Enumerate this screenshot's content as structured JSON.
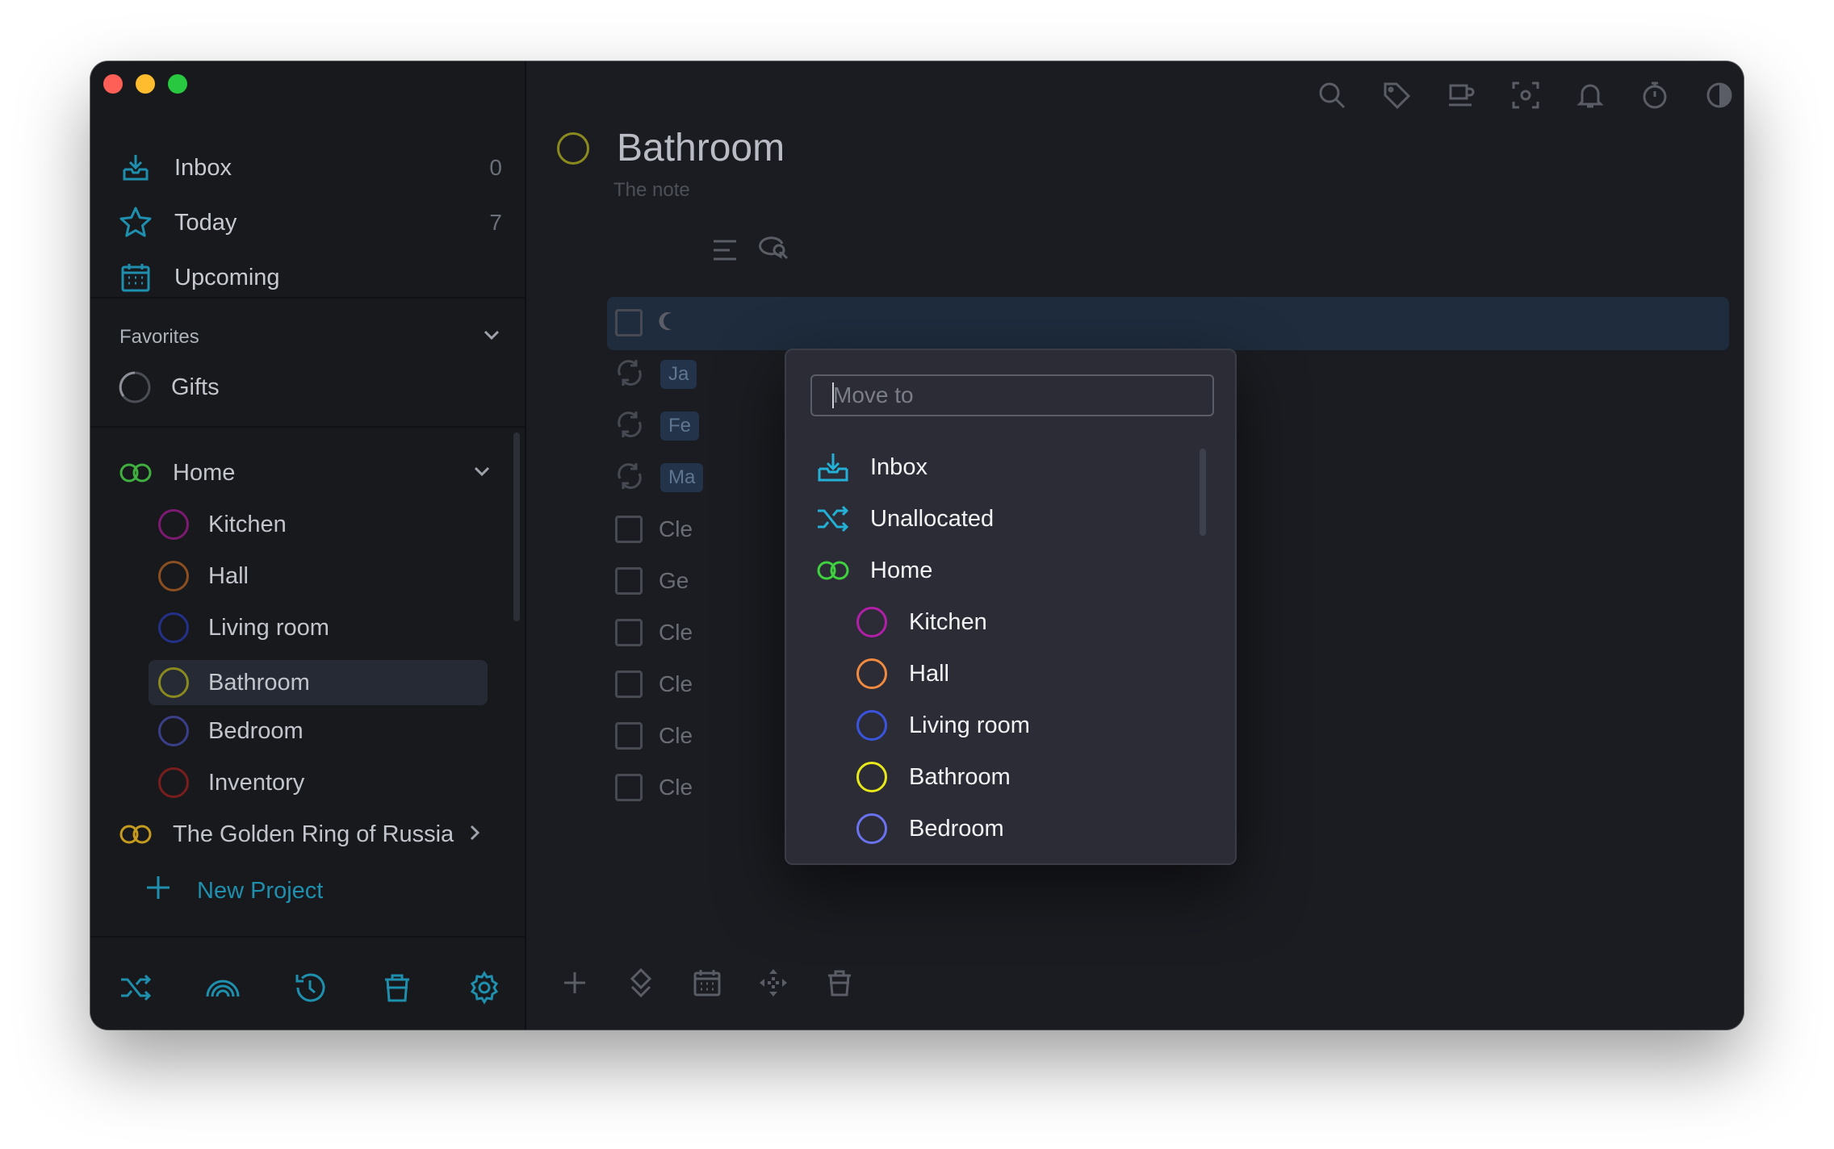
{
  "sidebar": {
    "nav": [
      {
        "label": "Inbox",
        "count": "0"
      },
      {
        "label": "Today",
        "count": "7"
      },
      {
        "label": "Upcoming",
        "count": ""
      }
    ],
    "favorites_label": "Favorites",
    "favorites": [
      {
        "label": "Gifts"
      }
    ],
    "home_label": "Home",
    "home_children": [
      {
        "label": "Kitchen",
        "color": "#7d1a72"
      },
      {
        "label": "Hall",
        "color": "#8c4f22"
      },
      {
        "label": "Living room",
        "color": "#23318a"
      },
      {
        "label": "Bathroom",
        "color": "#8a8a1f"
      },
      {
        "label": "Bedroom",
        "color": "#3a3f8a"
      },
      {
        "label": "Inventory",
        "color": "#7a1d1d"
      }
    ],
    "golden_ring_label": "The Golden Ring of Russia",
    "new_project_label": "New Project"
  },
  "main": {
    "title": "Bathroom",
    "note": "The note",
    "tasks": [
      {
        "text": "",
        "type": "checkbox"
      },
      {
        "text": "",
        "tag": "Ja",
        "type": "repeat"
      },
      {
        "text": "",
        "tag": "Fe",
        "type": "repeat"
      },
      {
        "text": "",
        "tag": "Ma",
        "type": "repeat"
      },
      {
        "text": "Cle",
        "type": "checkbox"
      },
      {
        "text": "Ge",
        "type": "checkbox"
      },
      {
        "text": "Cle",
        "type": "checkbox"
      },
      {
        "text": "Cle",
        "type": "checkbox"
      },
      {
        "text": "Cle",
        "type": "checkbox"
      },
      {
        "text": "Cle",
        "type": "checkbox"
      }
    ]
  },
  "move_popup": {
    "placeholder": "Move to",
    "items": [
      {
        "label": "Inbox",
        "icon": "inbox-icon"
      },
      {
        "label": "Unallocated",
        "icon": "shuffle-icon"
      },
      {
        "label": "Home",
        "icon": "rings-icon"
      },
      {
        "label": "Kitchen",
        "color": "#b31fa8"
      },
      {
        "label": "Hall",
        "color": "#f08a40"
      },
      {
        "label": "Living room",
        "color": "#3b54e0"
      },
      {
        "label": "Bathroom",
        "color": "#e8e81a"
      },
      {
        "label": "Bedroom",
        "color": "#6b72f0"
      }
    ]
  },
  "colors": {
    "accent": "#1f8fae",
    "home_rings": "#3fb03f",
    "golden_rings": "#c49a1f"
  }
}
